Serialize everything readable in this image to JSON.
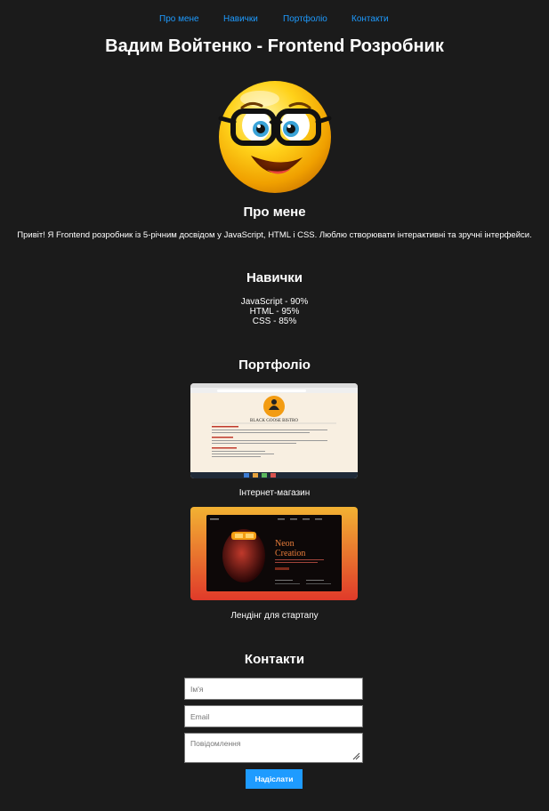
{
  "nav": {
    "items": [
      {
        "label": "Про мене"
      },
      {
        "label": "Навички"
      },
      {
        "label": "Портфоліо"
      },
      {
        "label": "Контакти"
      }
    ]
  },
  "header": {
    "title": "Вадим Войтенко - Frontend Розробник"
  },
  "about": {
    "heading": "Про мене",
    "text": "Привіт! Я Frontend розробник із 5-річним досвідом у JavaScript, HTML і CSS. Люблю створювати інтерактивні та зручні інтерфейси."
  },
  "skills": {
    "heading": "Навички",
    "items": [
      {
        "label": "JavaScript - 90%"
      },
      {
        "label": "HTML - 95%"
      },
      {
        "label": "CSS - 85%"
      }
    ]
  },
  "portfolio": {
    "heading": "Портфоліо",
    "projects": [
      {
        "caption": "Інтернет-магазин",
        "preview_title": "BLACK GOOSE BISTRO"
      },
      {
        "caption": "Лендінг для стартапу",
        "preview_title": "Neon Creation"
      }
    ]
  },
  "contacts": {
    "heading": "Контакти",
    "name_placeholder": "Ім'я",
    "email_placeholder": "Email",
    "message_placeholder": "Повідомлення",
    "submit_label": "Надіслати"
  },
  "colors": {
    "background": "#1b1b1b",
    "accent": "#1e9bff",
    "text": "#ffffff"
  }
}
